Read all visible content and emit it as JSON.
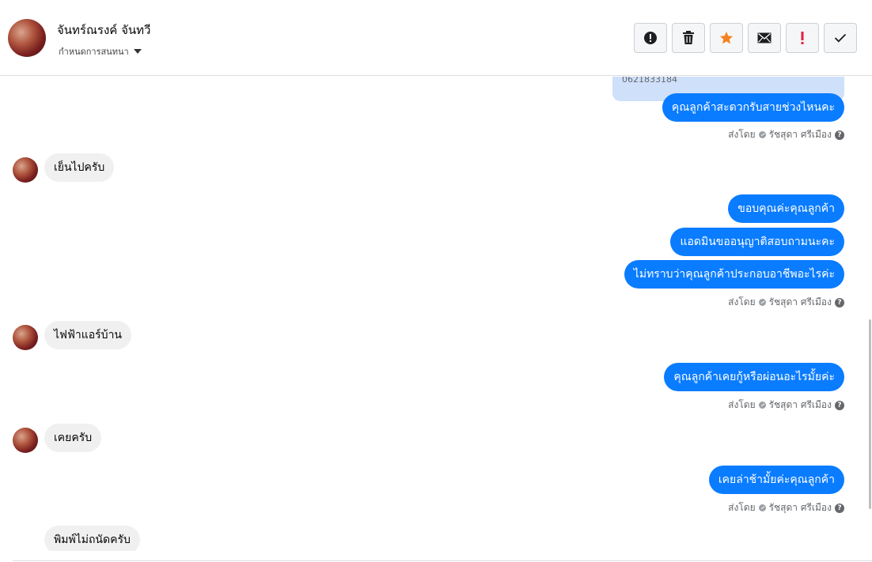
{
  "header": {
    "contact_name": "จันทร์ณรงค์ จันทวี",
    "assign_label": "กำหนดการสนทนา",
    "toolbar": {
      "icons": [
        "spam-icon",
        "trash-icon",
        "star-icon",
        "mail-icon",
        "exclamation-icon",
        "check-icon"
      ],
      "star_color": "#f5821f",
      "exclamation_color": "#e41e3f"
    }
  },
  "chat": {
    "card_phone": "0621833184",
    "sent_by_prefix": "ส่งโดย",
    "sent_by_name": "รัชสุดา ศรีเมือง",
    "help_glyph": "?",
    "messages": [
      {
        "dir": "out",
        "text": "คุณลูกค้าสะดวกรับสายช่วงไหนคะ"
      },
      {
        "dir": "in",
        "text": "เย็นไปครับ"
      },
      {
        "dir": "out",
        "text": "ขอบคุณค่ะคุณลูกค้า"
      },
      {
        "dir": "out",
        "text": "แอดมินขออนุญาติสอบถามนะคะ"
      },
      {
        "dir": "out",
        "text": "ไม่ทราบว่าคุณลูกค้าประกอบอาชีพอะไรค่ะ"
      },
      {
        "dir": "in",
        "text": "ไฟฟ้าแอร์บ้าน"
      },
      {
        "dir": "out",
        "text": "คุณลูกค้าเคยกู้หรือผ่อนอะไรมั้ยค่ะ"
      },
      {
        "dir": "in",
        "text": "เคยครับ"
      },
      {
        "dir": "out",
        "text": "เคยล่าช้ามั้ยค่ะคุณลูกค้า"
      },
      {
        "dir": "in",
        "text": "พิมพ์ไม่ถนัดครับ"
      }
    ]
  },
  "colors": {
    "outgoing_bubble": "#0a7cff",
    "incoming_bubble": "#f0f0f0",
    "card_bg": "#cfe0fb"
  }
}
